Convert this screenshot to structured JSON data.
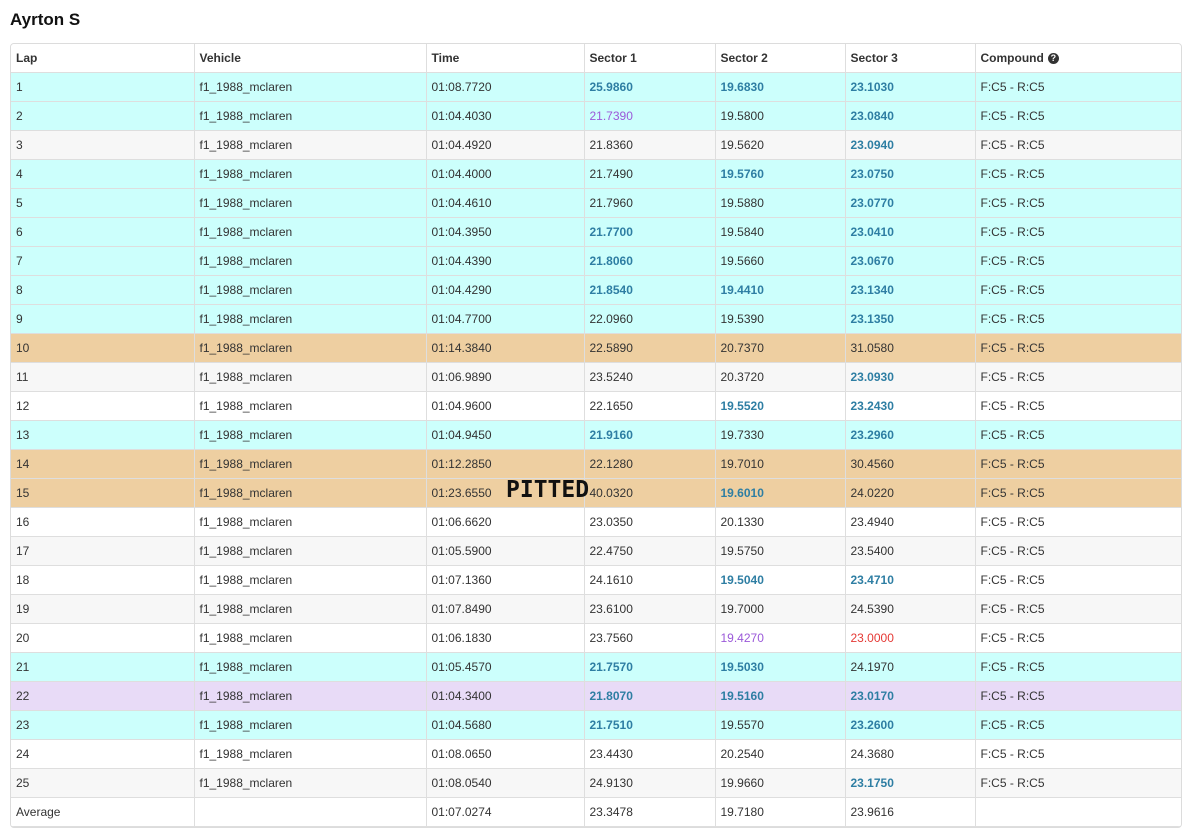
{
  "driver_name": "Ayrton S",
  "columns": {
    "lap": "Lap",
    "vehicle": "Vehicle",
    "time": "Time",
    "sector1": "Sector 1",
    "sector2": "Sector 2",
    "sector3": "Sector 3",
    "compound": "Compound"
  },
  "help_icon": "question-circle-icon",
  "pitted_label": "PITTED",
  "row_colors": {
    "good": "#ccfffc",
    "pit": "#eecfa1",
    "best": "#e8dbf7",
    "personal_best_text": "#2e7ea3",
    "overall_best_text": "#9b59d9",
    "slow_text": "#e53935"
  },
  "rows": [
    {
      "lap": "1",
      "vehicle": "f1_1988_mclaren",
      "time": "01:08.7720",
      "s1": "25.9860",
      "s2": "19.6830",
      "s3": "23.1030",
      "compound": "F:C5 - R:C5",
      "row": "good",
      "s1f": "pb",
      "s2f": "pb",
      "s3f": "pb"
    },
    {
      "lap": "2",
      "vehicle": "f1_1988_mclaren",
      "time": "01:04.4030",
      "s1": "21.7390",
      "s2": "19.5800",
      "s3": "23.0840",
      "compound": "F:C5 - R:C5",
      "row": "good",
      "s1f": "ob",
      "s2f": "",
      "s3f": "pb"
    },
    {
      "lap": "3",
      "vehicle": "f1_1988_mclaren",
      "time": "01:04.4920",
      "s1": "21.8360",
      "s2": "19.5620",
      "s3": "23.0940",
      "compound": "F:C5 - R:C5",
      "row": "normal-alt",
      "s1f": "",
      "s2f": "",
      "s3f": "pb"
    },
    {
      "lap": "4",
      "vehicle": "f1_1988_mclaren",
      "time": "01:04.4000",
      "s1": "21.7490",
      "s2": "19.5760",
      "s3": "23.0750",
      "compound": "F:C5 - R:C5",
      "row": "good",
      "s1f": "",
      "s2f": "pb",
      "s3f": "pb"
    },
    {
      "lap": "5",
      "vehicle": "f1_1988_mclaren",
      "time": "01:04.4610",
      "s1": "21.7960",
      "s2": "19.5880",
      "s3": "23.0770",
      "compound": "F:C5 - R:C5",
      "row": "good",
      "s1f": "",
      "s2f": "",
      "s3f": "pb"
    },
    {
      "lap": "6",
      "vehicle": "f1_1988_mclaren",
      "time": "01:04.3950",
      "s1": "21.7700",
      "s2": "19.5840",
      "s3": "23.0410",
      "compound": "F:C5 - R:C5",
      "row": "good",
      "s1f": "pb",
      "s2f": "",
      "s3f": "pb"
    },
    {
      "lap": "7",
      "vehicle": "f1_1988_mclaren",
      "time": "01:04.4390",
      "s1": "21.8060",
      "s2": "19.5660",
      "s3": "23.0670",
      "compound": "F:C5 - R:C5",
      "row": "good",
      "s1f": "pb",
      "s2f": "",
      "s3f": "pb"
    },
    {
      "lap": "8",
      "vehicle": "f1_1988_mclaren",
      "time": "01:04.4290",
      "s1": "21.8540",
      "s2": "19.4410",
      "s3": "23.1340",
      "compound": "F:C5 - R:C5",
      "row": "good",
      "s1f": "pb",
      "s2f": "pb",
      "s3f": "pb"
    },
    {
      "lap": "9",
      "vehicle": "f1_1988_mclaren",
      "time": "01:04.7700",
      "s1": "22.0960",
      "s2": "19.5390",
      "s3": "23.1350",
      "compound": "F:C5 - R:C5",
      "row": "good",
      "s1f": "",
      "s2f": "",
      "s3f": "pb"
    },
    {
      "lap": "10",
      "vehicle": "f1_1988_mclaren",
      "time": "01:14.3840",
      "s1": "22.5890",
      "s2": "20.7370",
      "s3": "31.0580",
      "compound": "F:C5 - R:C5",
      "row": "pit",
      "s1f": "",
      "s2f": "",
      "s3f": ""
    },
    {
      "lap": "11",
      "vehicle": "f1_1988_mclaren",
      "time": "01:06.9890",
      "s1": "23.5240",
      "s2": "20.3720",
      "s3": "23.0930",
      "compound": "F:C5 - R:C5",
      "row": "normal-alt",
      "s1f": "",
      "s2f": "",
      "s3f": "pb"
    },
    {
      "lap": "12",
      "vehicle": "f1_1988_mclaren",
      "time": "01:04.9600",
      "s1": "22.1650",
      "s2": "19.5520",
      "s3": "23.2430",
      "compound": "F:C5 - R:C5",
      "row": "normal",
      "s1f": "",
      "s2f": "pb",
      "s3f": "pb"
    },
    {
      "lap": "13",
      "vehicle": "f1_1988_mclaren",
      "time": "01:04.9450",
      "s1": "21.9160",
      "s2": "19.7330",
      "s3": "23.2960",
      "compound": "F:C5 - R:C5",
      "row": "good",
      "s1f": "pb",
      "s2f": "",
      "s3f": "pb"
    },
    {
      "lap": "14",
      "vehicle": "f1_1988_mclaren",
      "time": "01:12.2850",
      "s1": "22.1280",
      "s2": "19.7010",
      "s3": "30.4560",
      "compound": "F:C5 - R:C5",
      "row": "pit",
      "s1f": "",
      "s2f": "",
      "s3f": ""
    },
    {
      "lap": "15",
      "vehicle": "f1_1988_mclaren",
      "time": "01:23.6550",
      "s1": "40.0320",
      "s2": "19.6010",
      "s3": "24.0220",
      "compound": "F:C5 - R:C5",
      "row": "pit",
      "s1f": "",
      "s2f": "pb",
      "s3f": ""
    },
    {
      "lap": "16",
      "vehicle": "f1_1988_mclaren",
      "time": "01:06.6620",
      "s1": "23.0350",
      "s2": "20.1330",
      "s3": "23.4940",
      "compound": "F:C5 - R:C5",
      "row": "normal",
      "s1f": "",
      "s2f": "",
      "s3f": ""
    },
    {
      "lap": "17",
      "vehicle": "f1_1988_mclaren",
      "time": "01:05.5900",
      "s1": "22.4750",
      "s2": "19.5750",
      "s3": "23.5400",
      "compound": "F:C5 - R:C5",
      "row": "normal-alt",
      "s1f": "",
      "s2f": "",
      "s3f": ""
    },
    {
      "lap": "18",
      "vehicle": "f1_1988_mclaren",
      "time": "01:07.1360",
      "s1": "24.1610",
      "s2": "19.5040",
      "s3": "23.4710",
      "compound": "F:C5 - R:C5",
      "row": "normal",
      "s1f": "",
      "s2f": "pb",
      "s3f": "pb"
    },
    {
      "lap": "19",
      "vehicle": "f1_1988_mclaren",
      "time": "01:07.8490",
      "s1": "23.6100",
      "s2": "19.7000",
      "s3": "24.5390",
      "compound": "F:C5 - R:C5",
      "row": "normal-alt",
      "s1f": "",
      "s2f": "",
      "s3f": ""
    },
    {
      "lap": "20",
      "vehicle": "f1_1988_mclaren",
      "time": "01:06.1830",
      "s1": "23.7560",
      "s2": "19.4270",
      "s3": "23.0000",
      "compound": "F:C5 - R:C5",
      "row": "normal",
      "s1f": "",
      "s2f": "ob",
      "s3f": "red"
    },
    {
      "lap": "21",
      "vehicle": "f1_1988_mclaren",
      "time": "01:05.4570",
      "s1": "21.7570",
      "s2": "19.5030",
      "s3": "24.1970",
      "compound": "F:C5 - R:C5",
      "row": "good",
      "s1f": "pb",
      "s2f": "pb",
      "s3f": ""
    },
    {
      "lap": "22",
      "vehicle": "f1_1988_mclaren",
      "time": "01:04.3400",
      "s1": "21.8070",
      "s2": "19.5160",
      "s3": "23.0170",
      "compound": "F:C5 - R:C5",
      "row": "best",
      "s1f": "pb",
      "s2f": "pb",
      "s3f": "pb"
    },
    {
      "lap": "23",
      "vehicle": "f1_1988_mclaren",
      "time": "01:04.5680",
      "s1": "21.7510",
      "s2": "19.5570",
      "s3": "23.2600",
      "compound": "F:C5 - R:C5",
      "row": "good",
      "s1f": "pb",
      "s2f": "",
      "s3f": "pb"
    },
    {
      "lap": "24",
      "vehicle": "f1_1988_mclaren",
      "time": "01:08.0650",
      "s1": "23.4430",
      "s2": "20.2540",
      "s3": "24.3680",
      "compound": "F:C5 - R:C5",
      "row": "normal",
      "s1f": "",
      "s2f": "",
      "s3f": ""
    },
    {
      "lap": "25",
      "vehicle": "f1_1988_mclaren",
      "time": "01:08.0540",
      "s1": "24.9130",
      "s2": "19.9660",
      "s3": "23.1750",
      "compound": "F:C5 - R:C5",
      "row": "normal-alt",
      "s1f": "",
      "s2f": "",
      "s3f": "pb"
    }
  ],
  "average": {
    "label": "Average",
    "vehicle": "",
    "time": "01:07.0274",
    "s1": "23.3478",
    "s2": "19.7180",
    "s3": "23.9616",
    "compound": ""
  }
}
